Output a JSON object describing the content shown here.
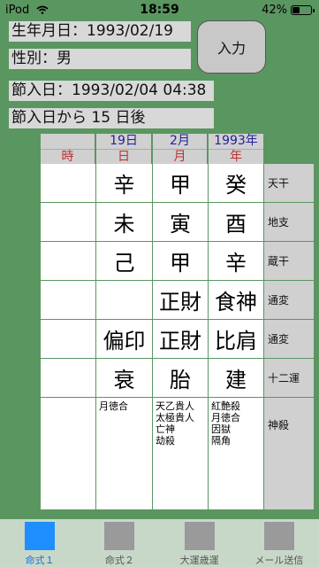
{
  "status": {
    "carrier": "iPod",
    "time": "18:59",
    "battery": "42%"
  },
  "info": {
    "birthdate": "生年月日：1993/02/19",
    "gender": "性別：男",
    "setsuiribi": "節入日：1993/02/04 04:38",
    "days_after": "節入日から 15 日後"
  },
  "input_button": "入力",
  "header": {
    "top": [
      "",
      "19日",
      "2月",
      "1993年"
    ],
    "bottom": [
      "時",
      "日",
      "月",
      "年"
    ]
  },
  "rows": [
    {
      "cells": [
        "",
        "辛",
        "甲",
        "癸"
      ],
      "label": "天干"
    },
    {
      "cells": [
        "",
        "未",
        "寅",
        "酉"
      ],
      "label": "地支"
    },
    {
      "cells": [
        "",
        "己",
        "甲",
        "辛"
      ],
      "label": "蔵干"
    },
    {
      "cells": [
        "",
        "",
        "正財",
        "食神"
      ],
      "label": "通変"
    },
    {
      "cells": [
        "",
        "偏印",
        "正財",
        "比肩"
      ],
      "label": "通変"
    },
    {
      "cells": [
        "",
        "衰",
        "胎",
        "建"
      ],
      "label": "十二運"
    }
  ],
  "shinsatsu": {
    "label": "神殺",
    "hour": [],
    "day": [
      "月徳合"
    ],
    "month": [
      "天乙貴人",
      "太極貴人",
      "亡神",
      "劫殺"
    ],
    "year": [
      "紅艶殺",
      "月徳合",
      "因獄",
      "隔角"
    ]
  },
  "tabs": [
    {
      "label": "命式１",
      "active": true
    },
    {
      "label": "命式２",
      "active": false
    },
    {
      "label": "大運歳運",
      "active": false
    },
    {
      "label": "メール送信",
      "active": false
    }
  ],
  "colors": {
    "accent": "#1f8fff",
    "background": "#5a9660"
  }
}
